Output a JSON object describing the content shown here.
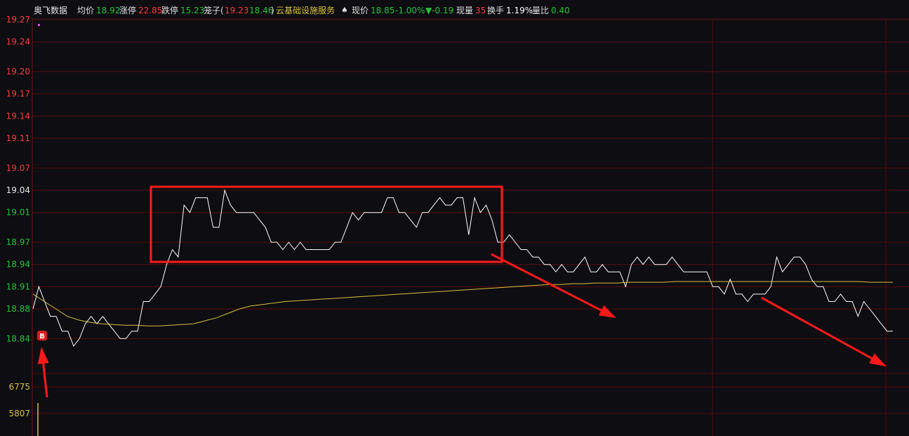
{
  "header": {
    "stock_name": "奥飞数据",
    "avg_label": "均价",
    "avg_value": "18.92",
    "limit_up_label": "涨停",
    "limit_up_value": "22.85",
    "limit_down_label": "跌停",
    "limit_down_value": "15.23",
    "cage_label": "笼子(",
    "cage_high": "19.23",
    "cage_low": "18.46",
    "cage_close": ")",
    "sector": "云基础设施服务",
    "price_label": "现价",
    "price_value": "18.85",
    "change_pct": "-1.00%",
    "change_value": "▼-0.19",
    "volume_label": "现量",
    "volume_value": "35",
    "turnover_label": "换手",
    "turnover_value": "1.19%",
    "ratio_label": "量比",
    "ratio_value": "0.40"
  },
  "colors": {
    "background": "#0d0d12",
    "grid": "#5a0c0c",
    "price_line": "#ffffff",
    "avg_line": "#d8c23a",
    "up_text": "#ff3b3b",
    "down_text": "#27c437",
    "annotation": "#ff1a1a"
  },
  "marker": {
    "text": "B"
  },
  "chart_data": {
    "type": "line",
    "title": "",
    "xlabel": "",
    "ylabel": "",
    "ylim": [
      18.81,
      19.27
    ],
    "y_ticks": [
      {
        "label": "19.27",
        "value": 19.27,
        "color": "#ff3b3b"
      },
      {
        "label": "19.24",
        "value": 19.24,
        "color": "#ff3b3b"
      },
      {
        "label": "19.20",
        "value": 19.2,
        "color": "#ff3b3b"
      },
      {
        "label": "19.17",
        "value": 19.17,
        "color": "#ff3b3b"
      },
      {
        "label": "19.14",
        "value": 19.14,
        "color": "#ff3b3b"
      },
      {
        "label": "19.11",
        "value": 19.11,
        "color": "#ff3b3b"
      },
      {
        "label": "19.07",
        "value": 19.07,
        "color": "#ff3b3b"
      },
      {
        "label": "19.04",
        "value": 19.04,
        "color": "#e8e8e8"
      },
      {
        "label": "19.01",
        "value": 19.01,
        "color": "#27c437"
      },
      {
        "label": "18.97",
        "value": 18.97,
        "color": "#27c437"
      },
      {
        "label": "18.94",
        "value": 18.94,
        "color": "#27c437"
      },
      {
        "label": "18.91",
        "value": 18.91,
        "color": "#27c437"
      },
      {
        "label": "18.88",
        "value": 18.88,
        "color": "#27c437"
      },
      {
        "label": "18.84",
        "value": 18.84,
        "color": "#27c437"
      }
    ],
    "volume_ticks": [
      "6775",
      "5807"
    ],
    "series": [
      {
        "values": [
          18.88,
          18.91,
          18.89,
          18.87,
          18.87,
          18.85,
          18.85,
          18.83,
          18.84,
          18.86,
          18.87,
          18.86,
          18.87,
          18.86,
          18.85,
          18.84,
          18.84,
          18.85,
          18.85,
          18.89,
          18.89,
          18.9,
          18.91,
          18.94,
          18.96,
          18.95,
          19.02,
          19.01,
          19.03,
          19.03,
          19.03,
          18.99,
          18.99,
          19.04,
          19.02,
          19.01,
          19.01,
          19.01,
          19.01,
          19.0,
          18.99,
          18.97,
          18.97,
          18.96,
          18.97,
          18.96,
          18.97,
          18.96,
          18.96,
          18.96,
          18.96,
          18.96,
          18.97,
          18.97,
          18.99,
          19.01,
          19.0,
          19.01,
          19.01,
          19.01,
          19.01,
          19.03,
          19.03,
          19.01,
          19.01,
          19.0,
          18.99,
          19.01,
          19.01,
          19.02,
          19.03,
          19.02,
          19.02,
          19.03,
          19.03,
          18.98,
          19.03,
          19.01,
          19.02,
          19.0,
          18.97,
          18.97,
          18.98,
          18.97,
          18.96,
          18.96,
          18.95,
          18.95,
          18.94,
          18.94,
          18.93,
          18.94,
          18.93,
          18.93,
          18.94,
          18.95,
          18.93,
          18.93,
          18.94,
          18.93,
          18.93,
          18.93,
          18.91,
          18.94,
          18.95,
          18.94,
          18.95,
          18.94,
          18.94,
          18.94,
          18.95,
          18.94,
          18.93,
          18.93,
          18.93,
          18.93,
          18.93,
          18.91,
          18.91,
          18.9,
          18.92,
          18.9,
          18.9,
          18.89,
          18.9,
          18.9,
          18.9,
          18.91,
          18.95,
          18.93,
          18.94,
          18.95,
          18.95,
          18.94,
          18.92,
          18.91,
          18.91,
          18.89,
          18.89,
          18.9,
          18.89,
          18.89,
          18.87,
          18.89,
          18.88,
          18.87,
          18.86,
          18.85,
          18.85
        ]
      },
      {
        "values": [
          18.9,
          18.89,
          18.88,
          18.87,
          18.865,
          18.862,
          18.86,
          18.859,
          18.858,
          18.858,
          18.857,
          18.857,
          18.858,
          18.859,
          18.86,
          18.864,
          18.868,
          18.874,
          18.88,
          18.884,
          18.886,
          18.888,
          18.89,
          18.891,
          18.892,
          18.893,
          18.894,
          18.895,
          18.896,
          18.897,
          18.898,
          18.899,
          18.9,
          18.901,
          18.902,
          18.903,
          18.904,
          18.905,
          18.906,
          18.907,
          18.908,
          18.909,
          18.91,
          18.911,
          18.912,
          18.913,
          18.913,
          18.914,
          18.914,
          18.915,
          18.915,
          18.915,
          18.916,
          18.916,
          18.916,
          18.916,
          18.917,
          18.917,
          18.917,
          18.917,
          18.917,
          18.917,
          18.917,
          18.917,
          18.917,
          18.917,
          18.917,
          18.917,
          18.917,
          18.917,
          18.917,
          18.917,
          18.917,
          18.916,
          18.916,
          18.916
        ]
      }
    ]
  }
}
